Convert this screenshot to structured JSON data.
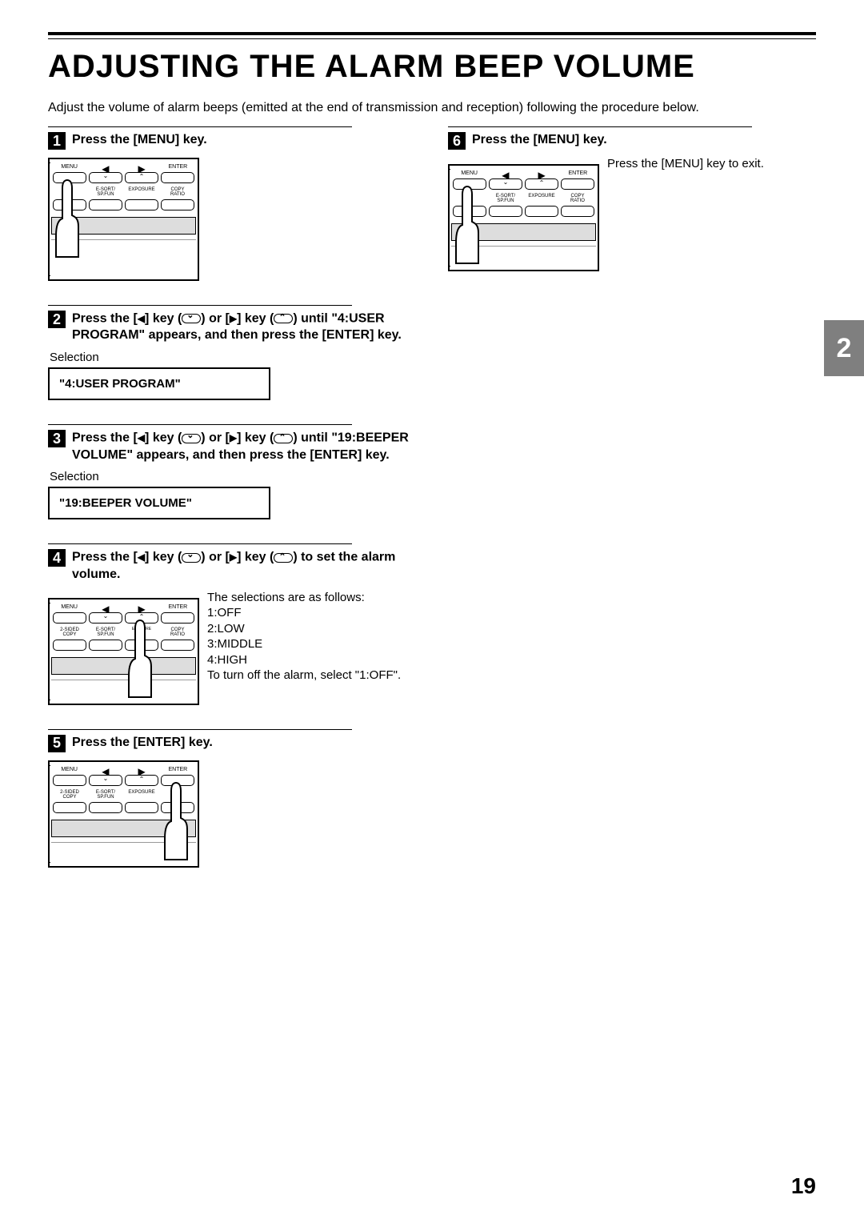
{
  "page": {
    "title": "ADJUSTING THE ALARM BEEP VOLUME",
    "intro": "Adjust the volume of alarm beeps (emitted at the end of transmission and reception) following the procedure below.",
    "page_number": "19",
    "side_tab": "2"
  },
  "panel_labels": {
    "menu": "MENU",
    "enter": "ENTER",
    "two_sided": "2-SIDED\nCOPY",
    "esort": "E-SORT/\nSP.FUN",
    "exposure": "EXPOSURE",
    "copy_ratio": "COPY\nRATIO",
    "ed_y": "ED\nY",
    "ure": "URE"
  },
  "steps": {
    "s1": {
      "num": "1",
      "title": "Press the [MENU] key."
    },
    "s2": {
      "num": "2",
      "title_pre": "Press the [",
      "title_mid1": "] key (",
      "title_mid2": ") or [",
      "title_mid3": "] key (",
      "title_post": ") until \"4:USER PROGRAM\" appears, and then press the [ENTER] key.",
      "selection_label": "Selection",
      "lcd": "\"4:USER PROGRAM\""
    },
    "s3": {
      "num": "3",
      "title_pre": "Press the [",
      "title_mid1": "] key (",
      "title_mid2": ") or [",
      "title_mid3": "] key (",
      "title_post": ") until \"19:BEEPER VOLUME\" appears, and then press the [ENTER] key.",
      "selection_label": "Selection",
      "lcd": "\"19:BEEPER VOLUME\""
    },
    "s4": {
      "num": "4",
      "title_pre": "Press the [",
      "title_mid1": "] key (",
      "title_mid2": ") or [",
      "title_mid3": "] key (",
      "title_post": ") to set the alarm volume.",
      "body": "The selections are as follows:\n1:OFF\n2:LOW\n3:MIDDLE\n4:HIGH\nTo turn off the alarm, select \"1:OFF\"."
    },
    "s5": {
      "num": "5",
      "title": "Press the [ENTER] key."
    },
    "s6": {
      "num": "6",
      "title": "Press the [MENU] key.",
      "body": "Press the [MENU] key to exit."
    }
  }
}
